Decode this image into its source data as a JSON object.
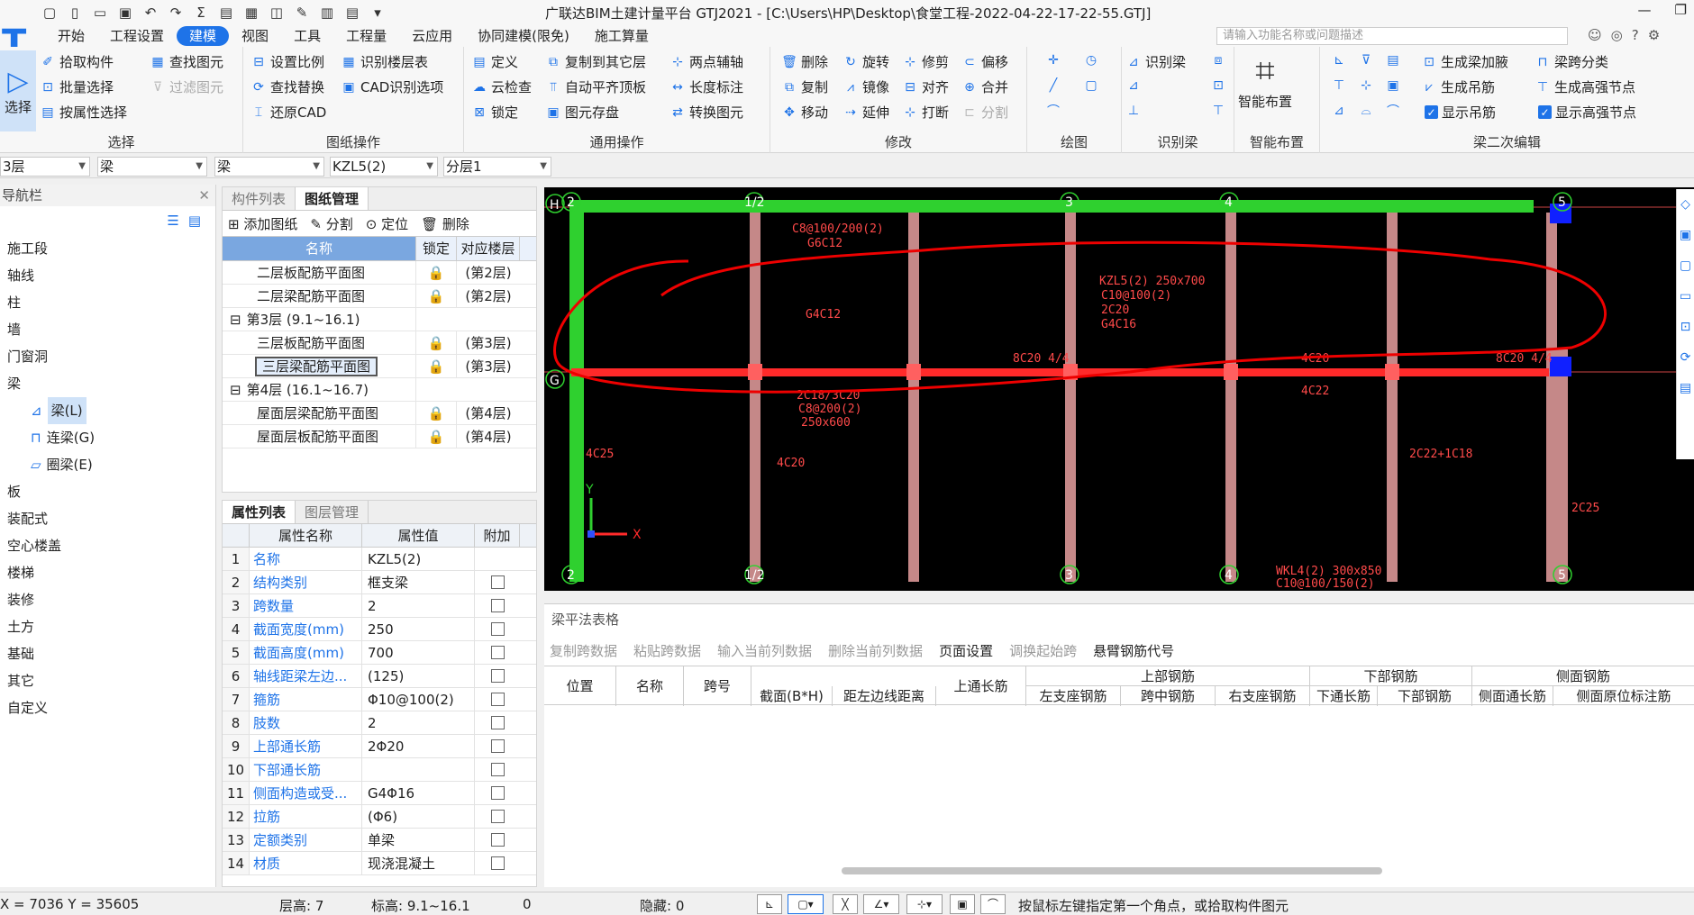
{
  "app": {
    "title": "广联达BIM土建计量平台 GTJ2021 - [C:\\Users\\HP\\Desktop\\食堂工程-2022-04-22-17-22-55.GTJ]",
    "logo": "T"
  },
  "window": {
    "minimize": "—",
    "restore": "❐",
    "close": "✕"
  },
  "menu": [
    "开始",
    "工程设置",
    "建模",
    "视图",
    "工具",
    "工程量",
    "云应用",
    "协同建模(限免)",
    "施工算量"
  ],
  "menu_active": "建模",
  "search": {
    "placeholder": "请输入功能名称或问题描述"
  },
  "ribbon": {
    "select": {
      "big": "选择",
      "items": [
        "拾取构件",
        "批量选择",
        "按属性选择",
        "查找图元",
        "过滤图元"
      ],
      "title": "选择"
    },
    "drawing": {
      "items": [
        "设置比例",
        "识别楼层表",
        "查找替换",
        "CAD识别选项",
        "还原CAD"
      ],
      "title": "图纸操作"
    },
    "common": {
      "items": [
        "定义",
        "复制到其它层",
        "两点辅轴",
        "云检查",
        "自动平齐顶板",
        "长度标注",
        "锁定",
        "图元存盘",
        "转换图元"
      ],
      "title": "通用操作"
    },
    "modify": {
      "items": [
        "删除",
        "旋转",
        "修剪",
        "偏移",
        "复制",
        "镜像",
        "对齐",
        "合并",
        "移动",
        "延伸",
        "打断",
        "分割"
      ],
      "title": "修改"
    },
    "draw": {
      "title": "绘图"
    },
    "recog": {
      "items": [
        "识别梁"
      ],
      "title": "识别梁"
    },
    "smart": {
      "big": "智能布置",
      "title": "智能布置"
    },
    "secondary": {
      "items": [
        "生成梁加腋",
        "梁跨分类",
        "生成吊筋",
        "生成高强节点",
        "显示吊筋",
        "显示高强节点"
      ],
      "title": "梁二次编辑"
    }
  },
  "dropdowns": [
    "3层",
    "梁",
    "梁",
    "KZL5(2)",
    "分层1"
  ],
  "nav": {
    "title": "导航栏",
    "items": [
      "施工段",
      "轴线",
      "柱",
      "墙",
      "门窗洞",
      "梁",
      "板",
      "装配式",
      "空心楼盖",
      "楼梯",
      "装修",
      "土方",
      "基础",
      "其它",
      "自定义"
    ],
    "sub": [
      "梁(L)",
      "连梁(G)",
      "圈梁(E)"
    ]
  },
  "drawings_panel": {
    "tabs": [
      "构件列表",
      "图纸管理"
    ],
    "toolbar": [
      "添加图纸",
      "分割",
      "定位",
      "删除"
    ],
    "headers": [
      "名称",
      "锁定",
      "对应楼层"
    ],
    "rows": [
      {
        "name": "二层板配筋平面图",
        "floor": "(第2层)",
        "group": false
      },
      {
        "name": "二层梁配筋平面图",
        "floor": "(第2层)",
        "group": false
      },
      {
        "name": "第3层 (9.1~16.1)",
        "floor": "",
        "group": true
      },
      {
        "name": "三层板配筋平面图",
        "floor": "(第3层)",
        "group": false
      },
      {
        "name": "三层梁配筋平面图",
        "floor": "(第3层)",
        "group": false
      },
      {
        "name": "第4层 (16.1~16.7)",
        "floor": "",
        "group": true
      },
      {
        "name": "屋面层梁配筋平面图",
        "floor": "(第4层)",
        "group": false
      },
      {
        "name": "屋面层板配筋平面图",
        "floor": "(第4层)",
        "group": false
      }
    ]
  },
  "props_panel": {
    "tabs": [
      "属性列表",
      "图层管理"
    ],
    "headers": [
      "属性名称",
      "属性值",
      "附加"
    ],
    "rows": [
      {
        "n": "1",
        "name": "名称",
        "value": "KZL5(2)"
      },
      {
        "n": "2",
        "name": "结构类别",
        "value": "框支梁"
      },
      {
        "n": "3",
        "name": "跨数量",
        "value": "2"
      },
      {
        "n": "4",
        "name": "截面宽度(mm)",
        "value": "250"
      },
      {
        "n": "5",
        "name": "截面高度(mm)",
        "value": "700"
      },
      {
        "n": "6",
        "name": "轴线距梁左边...",
        "value": "(125)"
      },
      {
        "n": "7",
        "name": "箍筋",
        "value": "Φ10@100(2)"
      },
      {
        "n": "8",
        "name": "肢数",
        "value": "2"
      },
      {
        "n": "9",
        "name": "上部通长筋",
        "value": "2Φ20"
      },
      {
        "n": "10",
        "name": "下部通长筋",
        "value": ""
      },
      {
        "n": "11",
        "name": "侧面构造或受...",
        "value": "G4Φ16"
      },
      {
        "n": "12",
        "name": "拉筋",
        "value": "(Φ6)"
      },
      {
        "n": "13",
        "name": "定额类别",
        "value": "单梁"
      },
      {
        "n": "14",
        "name": "材质",
        "value": "现浇混凝土"
      }
    ]
  },
  "cad": {
    "axes_top": [
      "2",
      "1/2",
      "3",
      "4",
      "5"
    ],
    "axes_left": [
      "H",
      "G"
    ],
    "labels": [
      "C8@100/200(2)",
      "G6C12",
      "G4C12",
      "8C20 4/4",
      "4C20",
      "8C20 4/4",
      "2C18/3C20",
      "C8@200(2)",
      "250x600",
      "KZL5(2) 250x700",
      "C10@100(2)",
      "2C20",
      "G4C16",
      "4C22",
      "4C25",
      "4C20",
      "2C22+1C18",
      "2C25",
      "WKL4(2) 300x850",
      "C10@100/150(2)"
    ],
    "x_axis": "X",
    "y_axis": "Y"
  },
  "grid_panel": {
    "title": "梁平法表格",
    "toolbar": [
      {
        "t": "复制跨数据",
        "en": false
      },
      {
        "t": "粘贴跨数据",
        "en": false
      },
      {
        "t": "输入当前列数据",
        "en": false
      },
      {
        "t": "删除当前列数据",
        "en": false
      },
      {
        "t": "页面设置",
        "en": true
      },
      {
        "t": "调换起始跨",
        "en": false
      },
      {
        "t": "悬臂钢筋代号",
        "en": true
      }
    ],
    "headers": {
      "pos": "位置",
      "name": "名称",
      "span": "跨号",
      "sec": "截面(B*H)",
      "dist": "距左边线距离",
      "top_cont": "上通长筋",
      "upper": "上部钢筋",
      "left_sup": "左支座钢筋",
      "mid": "跨中钢筋",
      "right_sup": "右支座钢筋",
      "lower": "下部钢筋",
      "bot_cont": "下通长筋",
      "bot": "下部钢筋",
      "side": "侧面钢筋",
      "side_cont": "侧面通长筋",
      "side_orig": "侧面原位标注筋"
    }
  },
  "status": {
    "coords": "X = 7036 Y = 35605",
    "floor_h": "层高: 7",
    "elev": "标高: 9.1~16.1",
    "count": "0",
    "hidden": "隐藏: 0",
    "hint": "按鼠标左键指定第一个角点，或拾取构件图元"
  },
  "colors": {
    "accent": "#1e73e8",
    "beam_green": "#2fd02f",
    "beam_red": "#ff2a2a",
    "column_pink": "#e8a0a0"
  }
}
